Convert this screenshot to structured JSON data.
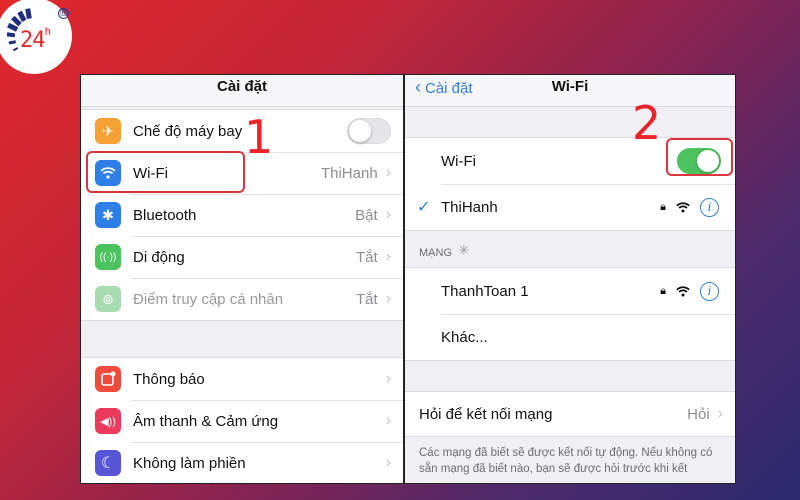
{
  "brand": {
    "logo_text": "24",
    "logo_superscript": "h",
    "registered_mark": "®",
    "logo_color": "#e32b2b"
  },
  "annotations": {
    "step1": "1",
    "step2": "2",
    "highlight_color": "#d8363c"
  },
  "left_panel": {
    "title": "Cài đặt",
    "group1": [
      {
        "icon": "airplane-icon",
        "glyph": "✈",
        "color": "#f5a033",
        "label": "Chế độ máy bay",
        "toggle": "off"
      },
      {
        "icon": "wifi-icon",
        "glyph": "",
        "color": "#2f7fe8",
        "label": "Wi-Fi",
        "value": "ThiHanh"
      },
      {
        "icon": "bluetooth-icon",
        "glyph": "✱",
        "color": "#2f7fe8",
        "label": "Bluetooth",
        "value": "Bật"
      },
      {
        "icon": "cellular-icon",
        "glyph": "((·))",
        "color": "#4cc35f",
        "label": "Di động",
        "value": "Tắt"
      },
      {
        "icon": "hotspot-icon",
        "glyph": "⊚",
        "color": "#a8dcb0",
        "label": "Điểm truy cập cá nhân",
        "value": "Tắt",
        "dimmed": true
      }
    ],
    "group2": [
      {
        "icon": "notifications-icon",
        "glyph": "▣",
        "color": "#ef4b3d",
        "label": "Thông báo"
      },
      {
        "icon": "sound-icon",
        "glyph": "◀))",
        "color": "#ec3a5c",
        "label": "Âm thanh & Cảm ứng"
      },
      {
        "icon": "moon-icon",
        "glyph": "☾",
        "color": "#5856d6",
        "label": "Không làm phiền"
      }
    ]
  },
  "right_panel": {
    "back_label": "Cài đặt",
    "title": "Wi-Fi",
    "wifi_toggle_label": "Wi-Fi",
    "wifi_toggle": "on",
    "connected_network": "ThiHanh",
    "section_header": "MẠNG",
    "networks": [
      "ThanhToan 1"
    ],
    "other_label": "Khác...",
    "ask_join_label": "Hỏi để kết nối mạng",
    "ask_join_value": "Hỏi",
    "footer": "Các mạng đã biết sẽ được kết nối tự động. Nếu không có sẵn mạng đã biết nào, bạn sẽ được hỏi trước khi kết"
  }
}
